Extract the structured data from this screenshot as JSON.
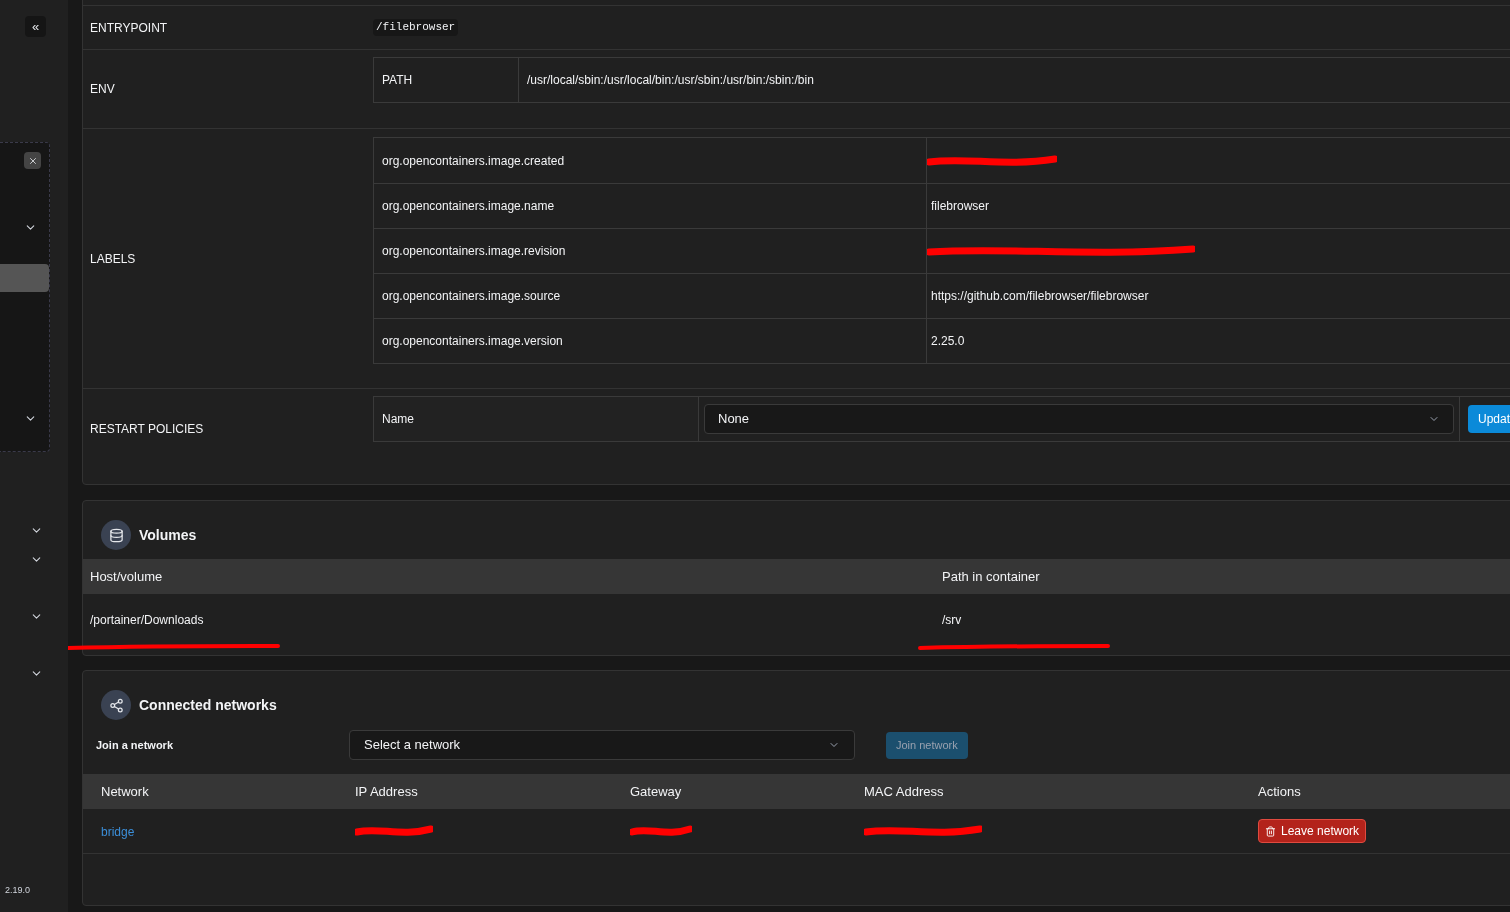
{
  "sidebar": {
    "collapse_icon": "«",
    "panel": {
      "items": [
        {
          "kind": "group",
          "selected": false
        },
        {
          "kind": "link",
          "selected": true
        },
        {
          "kind": "group",
          "selected": false
        }
      ]
    },
    "groups": [
      {
        "expanded": false
      },
      {
        "expanded": false
      },
      {
        "expanded": false
      },
      {
        "expanded": false
      }
    ],
    "version": "2.19.0"
  },
  "details": {
    "entrypoint": {
      "label": "ENTRYPOINT",
      "value": "/filebrowser"
    },
    "env": {
      "label": "ENV",
      "rows": [
        {
          "key": "PATH",
          "value": "/usr/local/sbin:/usr/local/bin:/usr/sbin:/usr/bin:/sbin:/bin"
        }
      ]
    },
    "labels": {
      "label": "LABELS",
      "rows": [
        {
          "key": "org.opencontainers.image.created",
          "redacted": true
        },
        {
          "key": "org.opencontainers.image.name",
          "value": "filebrowser",
          "redacted": false
        },
        {
          "key": "org.opencontainers.image.revision",
          "redacted": true
        },
        {
          "key": "org.opencontainers.image.source",
          "value": "https://github.com/filebrowser/filebrowser",
          "redacted": false
        },
        {
          "key": "org.opencontainers.image.version",
          "value": "2.25.0",
          "redacted": false
        }
      ]
    },
    "restart": {
      "label": "RESTART POLICIES",
      "field": "Name",
      "value": "None",
      "button": "Updat"
    }
  },
  "volumes": {
    "title": "Volumes",
    "columns": [
      "Host/volume",
      "Path in container"
    ],
    "rows": [
      {
        "cells": [
          {
            "text": "/portainer/Downloads",
            "underlined": true
          },
          {
            "text": "/srv",
            "underlined": true
          }
        ]
      }
    ]
  },
  "networks": {
    "title": "Connected networks",
    "join_label": "Join a network",
    "select_placeholder": "Select a network",
    "join_button": {
      "label": "Join network",
      "disabled": true
    },
    "columns": [
      "Network",
      "IP Address",
      "Gateway",
      "MAC Address",
      "Actions"
    ],
    "rows": [
      {
        "network": "bridge",
        "ip": {
          "redacted": true
        },
        "gateway": {
          "redacted": true
        },
        "mac": {
          "redacted": true
        },
        "action": "Leave network"
      }
    ]
  }
}
